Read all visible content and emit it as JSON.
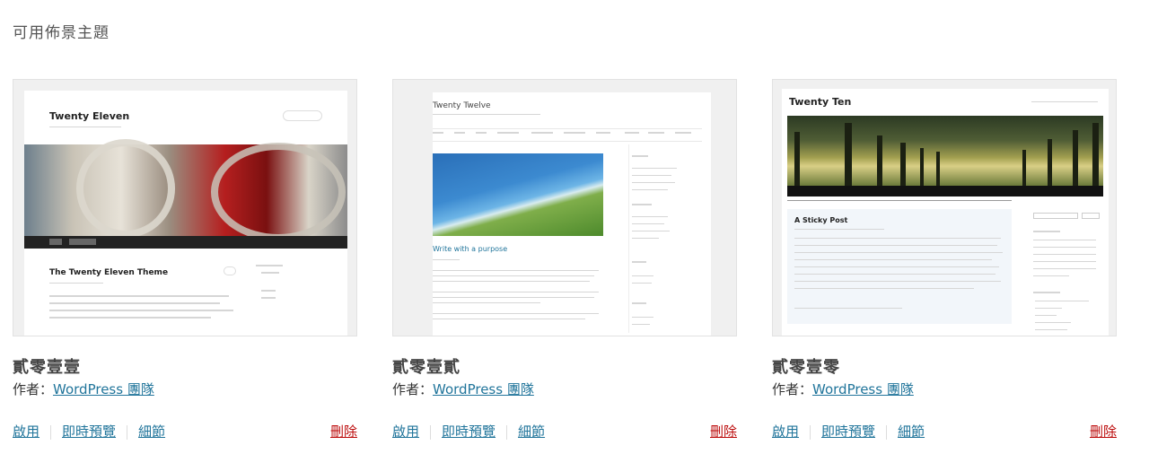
{
  "page": {
    "heading": "可用佈景主題"
  },
  "themes": [
    {
      "name": "貳零壹壹",
      "author_prefix": "作者：",
      "author_link": "WordPress 團隊",
      "actions": [
        "啟用",
        "即時預覽",
        "細節"
      ],
      "delete": "刪除",
      "preview": {
        "site_title": "Twenty Eleven",
        "post_title": "The Twenty Eleven Theme"
      }
    },
    {
      "name": "貳零壹貳",
      "author_prefix": "作者：",
      "author_link": "WordPress 團隊",
      "actions": [
        "啟用",
        "即時預覽",
        "細節"
      ],
      "delete": "刪除",
      "preview": {
        "site_title": "Twenty Twelve",
        "post_title": "Write with a purpose"
      }
    },
    {
      "name": "貳零壹零",
      "author_prefix": "作者：",
      "author_link": "WordPress 團隊",
      "actions": [
        "啟用",
        "即時預覽",
        "細節"
      ],
      "delete": "刪除",
      "preview": {
        "site_title": "Twenty Ten",
        "post_title": "A Sticky Post"
      }
    }
  ],
  "colors": {
    "link": "#21759b",
    "delete": "#bc0b0b"
  }
}
